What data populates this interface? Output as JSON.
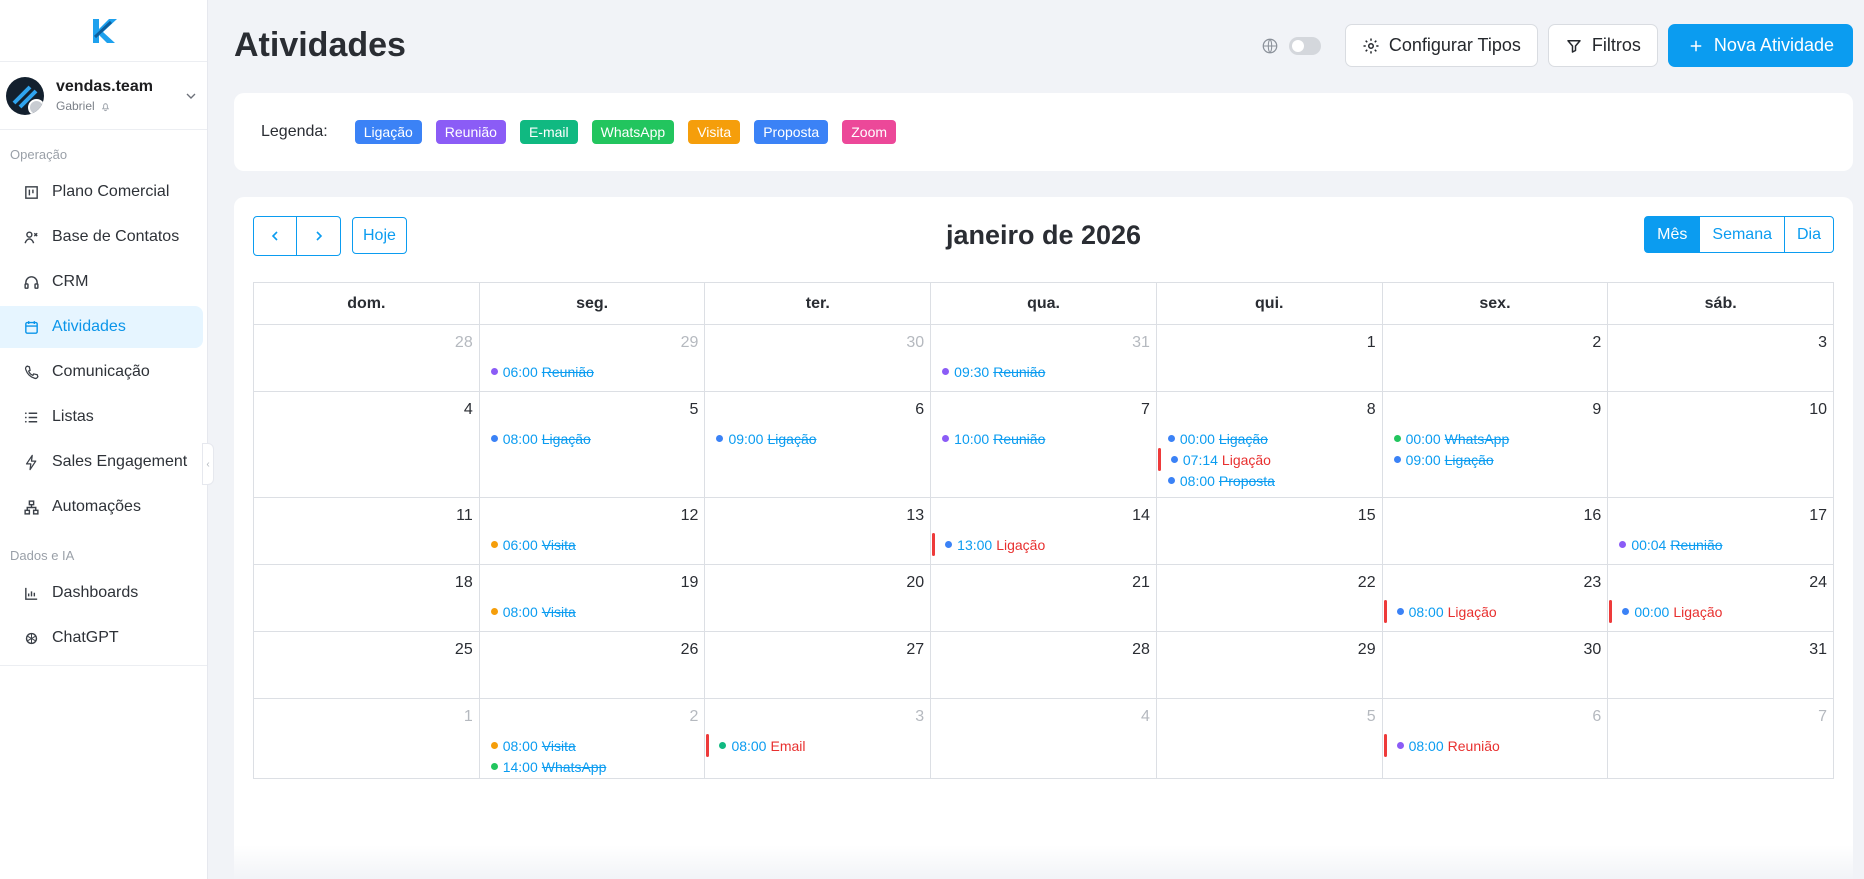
{
  "colors": {
    "accent": "#0b9cf0",
    "ligacao": "#3b82f6",
    "reuniao": "#8b5cf6",
    "email": "#10b981",
    "whatsapp": "#22c55e",
    "visita": "#f59e0b",
    "proposta": "#3b82f6",
    "zoom": "#ec4899",
    "pending": "#e8302f"
  },
  "sidebar": {
    "workspace_name": "vendas.team",
    "workspace_user": "Gabriel",
    "sections": [
      {
        "title": "Operação",
        "items": [
          {
            "label": "Plano Comercial",
            "icon": "kanban-icon",
            "active": false
          },
          {
            "label": "Base de Contatos",
            "icon": "contacts-icon",
            "active": false
          },
          {
            "label": "CRM",
            "icon": "headset-icon",
            "active": false
          },
          {
            "label": "Atividades",
            "icon": "calendar-icon",
            "active": true
          },
          {
            "label": "Comunicação",
            "icon": "phone-icon",
            "active": false
          },
          {
            "label": "Listas",
            "icon": "list-icon",
            "active": false
          },
          {
            "label": "Sales Engagement",
            "icon": "lightning-icon",
            "active": false
          },
          {
            "label": "Automações",
            "icon": "workflow-icon",
            "active": false
          }
        ]
      },
      {
        "title": "Dados e IA",
        "items": [
          {
            "label": "Dashboards",
            "icon": "bar-chart-icon",
            "active": false
          },
          {
            "label": "ChatGPT",
            "icon": "openai-icon",
            "active": false
          }
        ]
      }
    ]
  },
  "header": {
    "title": "Atividades",
    "configure_label": "Configurar Tipos",
    "filters_label": "Filtros",
    "new_label": "Nova Atividade"
  },
  "legend": {
    "label": "Legenda:",
    "items": [
      {
        "label": "Ligação",
        "color": "#3b82f6"
      },
      {
        "label": "Reunião",
        "color": "#8b5cf6"
      },
      {
        "label": "E-mail",
        "color": "#10b981"
      },
      {
        "label": "WhatsApp",
        "color": "#22c55e"
      },
      {
        "label": "Visita",
        "color": "#f59e0b"
      },
      {
        "label": "Proposta",
        "color": "#3b82f6"
      },
      {
        "label": "Zoom",
        "color": "#ec4899"
      }
    ]
  },
  "calendar": {
    "title": "janeiro de 2026",
    "today_label": "Hoje",
    "views": [
      {
        "label": "Mês",
        "active": true
      },
      {
        "label": "Semana",
        "active": false
      },
      {
        "label": "Dia",
        "active": false
      }
    ],
    "weekdays": [
      "dom.",
      "seg.",
      "ter.",
      "qua.",
      "qui.",
      "sex.",
      "sáb."
    ],
    "weeks": [
      [
        {
          "day": "28",
          "other": true,
          "events": []
        },
        {
          "day": "29",
          "other": true,
          "events": [
            {
              "time": "06:00",
              "type": "Reunião",
              "dot": "#8b5cf6",
              "done": true
            }
          ]
        },
        {
          "day": "30",
          "other": true,
          "events": []
        },
        {
          "day": "31",
          "other": true,
          "events": [
            {
              "time": "09:30",
              "type": "Reunião",
              "dot": "#8b5cf6",
              "done": true
            }
          ]
        },
        {
          "day": "1",
          "other": false,
          "events": []
        },
        {
          "day": "2",
          "other": false,
          "events": []
        },
        {
          "day": "3",
          "other": false,
          "events": []
        }
      ],
      [
        {
          "day": "4",
          "other": false,
          "events": []
        },
        {
          "day": "5",
          "other": false,
          "events": [
            {
              "time": "08:00",
              "type": "Ligação",
              "dot": "#3b82f6",
              "done": true
            }
          ]
        },
        {
          "day": "6",
          "other": false,
          "events": [
            {
              "time": "09:00",
              "type": "Ligação",
              "dot": "#3b82f6",
              "done": true
            }
          ]
        },
        {
          "day": "7",
          "other": false,
          "events": [
            {
              "time": "10:00",
              "type": "Reunião",
              "dot": "#8b5cf6",
              "done": true
            }
          ]
        },
        {
          "day": "8",
          "other": false,
          "events": [
            {
              "time": "00:00",
              "type": "Ligação",
              "dot": "#3b82f6",
              "done": true
            },
            {
              "time": "07:14",
              "type": "Ligação",
              "dot": "#3b82f6",
              "done": false
            },
            {
              "time": "08:00",
              "type": "Proposta",
              "dot": "#3b82f6",
              "done": true
            }
          ]
        },
        {
          "day": "9",
          "other": false,
          "events": [
            {
              "time": "00:00",
              "type": "WhatsApp",
              "dot": "#22c55e",
              "done": true
            },
            {
              "time": "09:00",
              "type": "Ligação",
              "dot": "#3b82f6",
              "done": true
            }
          ]
        },
        {
          "day": "10",
          "other": false,
          "events": []
        }
      ],
      [
        {
          "day": "11",
          "other": false,
          "events": []
        },
        {
          "day": "12",
          "other": false,
          "events": [
            {
              "time": "06:00",
              "type": "Visita",
              "dot": "#f59e0b",
              "done": true
            }
          ]
        },
        {
          "day": "13",
          "other": false,
          "events": []
        },
        {
          "day": "14",
          "other": false,
          "events": [
            {
              "time": "13:00",
              "type": "Ligação",
              "dot": "#3b82f6",
              "done": false
            }
          ]
        },
        {
          "day": "15",
          "other": false,
          "events": []
        },
        {
          "day": "16",
          "other": false,
          "events": []
        },
        {
          "day": "17",
          "other": false,
          "events": [
            {
              "time": "00:04",
              "type": "Reunião",
              "dot": "#8b5cf6",
              "done": true
            }
          ]
        }
      ],
      [
        {
          "day": "18",
          "other": false,
          "events": []
        },
        {
          "day": "19",
          "other": false,
          "events": [
            {
              "time": "08:00",
              "type": "Visita",
              "dot": "#f59e0b",
              "done": true
            }
          ]
        },
        {
          "day": "20",
          "other": false,
          "events": []
        },
        {
          "day": "21",
          "other": false,
          "events": []
        },
        {
          "day": "22",
          "other": false,
          "events": []
        },
        {
          "day": "23",
          "other": false,
          "events": [
            {
              "time": "08:00",
              "type": "Ligação",
              "dot": "#3b82f6",
              "done": false
            }
          ]
        },
        {
          "day": "24",
          "other": false,
          "events": [
            {
              "time": "00:00",
              "type": "Ligação",
              "dot": "#3b82f6",
              "done": false
            }
          ]
        }
      ],
      [
        {
          "day": "25",
          "other": false,
          "events": []
        },
        {
          "day": "26",
          "other": false,
          "events": []
        },
        {
          "day": "27",
          "other": false,
          "events": []
        },
        {
          "day": "28",
          "other": false,
          "events": []
        },
        {
          "day": "29",
          "other": false,
          "events": []
        },
        {
          "day": "30",
          "other": false,
          "events": []
        },
        {
          "day": "31",
          "other": false,
          "events": []
        }
      ],
      [
        {
          "day": "1",
          "other": true,
          "events": []
        },
        {
          "day": "2",
          "other": true,
          "events": [
            {
              "time": "08:00",
              "type": "Visita",
              "dot": "#f59e0b",
              "done": true
            },
            {
              "time": "14:00",
              "type": "WhatsApp",
              "dot": "#22c55e",
              "done": true
            }
          ]
        },
        {
          "day": "3",
          "other": true,
          "events": [
            {
              "time": "08:00",
              "type": "Email",
              "dot": "#10b981",
              "done": false
            }
          ]
        },
        {
          "day": "4",
          "other": true,
          "events": []
        },
        {
          "day": "5",
          "other": true,
          "events": []
        },
        {
          "day": "6",
          "other": true,
          "events": [
            {
              "time": "08:00",
              "type": "Reunião",
              "dot": "#8b5cf6",
              "done": false
            }
          ]
        },
        {
          "day": "7",
          "other": true,
          "events": []
        }
      ]
    ]
  }
}
